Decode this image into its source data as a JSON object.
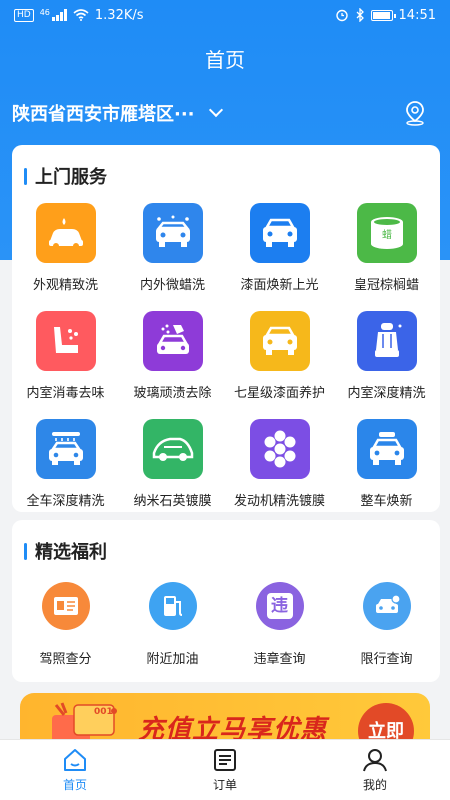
{
  "status_bar": {
    "badge": "HD",
    "network": "46",
    "speed": "1.32K/s",
    "time": "14:51"
  },
  "header": {
    "title": "首页"
  },
  "location": {
    "text": "陕西省西安市雁塔区···"
  },
  "services": {
    "title": "上门服务",
    "items": [
      {
        "label": "外观精致洗",
        "icon": "car-wash-icon",
        "color": "#ff9f1a"
      },
      {
        "label": "内外微蜡洗",
        "icon": "car-sparkle-icon",
        "color": "#2f86ec"
      },
      {
        "label": "漆面焕新上光",
        "icon": "car-front-icon",
        "color": "#1c7ef0"
      },
      {
        "label": "皇冠棕榈蜡",
        "icon": "wax-can-icon",
        "color": "#4cb947"
      },
      {
        "label": "内室消毒去味",
        "icon": "seat-disinfect-icon",
        "color": "#ff5a5f"
      },
      {
        "label": "玻璃顽渍去除",
        "icon": "glass-clean-icon",
        "color": "#8e3bd8"
      },
      {
        "label": "七星级漆面养护",
        "icon": "car-care-icon",
        "color": "#f6b81b"
      },
      {
        "label": "内室深度精洗",
        "icon": "car-seat-icon",
        "color": "#3b64e8"
      },
      {
        "label": "全车深度精洗",
        "icon": "car-shower-icon",
        "color": "#2e87e8"
      },
      {
        "label": "纳米石英镀膜",
        "icon": "car-coating-icon",
        "color": "#33b566"
      },
      {
        "label": "发动机精洗镀膜",
        "icon": "engine-honeycomb-icon",
        "color": "#7c4ee4"
      },
      {
        "label": "整车焕新",
        "icon": "car-renew-icon",
        "color": "#2b86ea"
      }
    ]
  },
  "benefits": {
    "title": "精选福利",
    "items": [
      {
        "label": "驾照查分",
        "icon": "license-icon",
        "color": "#f7893a"
      },
      {
        "label": "附近加油",
        "icon": "fuel-pump-icon",
        "color": "#3ea3f2"
      },
      {
        "label": "违章查询",
        "icon": "violation-icon",
        "glyph": "违",
        "color": "#8a63e0"
      },
      {
        "label": "限行查询",
        "icon": "restriction-icon",
        "color": "#4aa3f0"
      }
    ]
  },
  "banner": {
    "text": "充值立马享优惠",
    "button": "立即",
    "deco_text": "001"
  },
  "tabbar": {
    "items": [
      {
        "label": "首页",
        "icon": "home-icon",
        "active": true
      },
      {
        "label": "订单",
        "icon": "order-icon",
        "active": false
      },
      {
        "label": "我的",
        "icon": "profile-icon",
        "active": false
      }
    ]
  }
}
